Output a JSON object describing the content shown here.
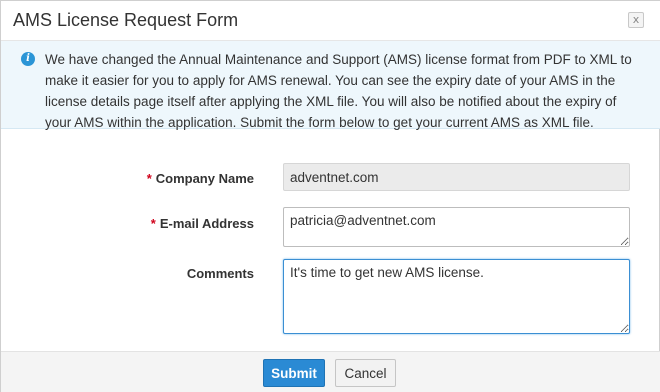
{
  "dialog": {
    "title": "AMS License Request Form",
    "close_glyph": "x"
  },
  "info": {
    "icon": "info-icon",
    "message": "We have changed the Annual Maintenance and Support (AMS) license format from PDF to XML to make it easier for you to apply for AMS renewal. You can see the expiry date of your AMS in the license details page itself after applying the XML file. You will also be notified about the expiry of your AMS within the application. Submit the form below to get your current AMS as XML file."
  },
  "form": {
    "required_mark": "*",
    "company": {
      "label": "Company Name",
      "value": "adventnet.com",
      "required": true
    },
    "email": {
      "label": "E-mail Address",
      "value": "patricia@adventnet.com",
      "required": true
    },
    "comments": {
      "label": "Comments",
      "value": "It's time to get new AMS license.",
      "required": false
    }
  },
  "footer": {
    "submit_label": "Submit",
    "cancel_label": "Cancel"
  },
  "colors": {
    "accent": "#2a8ad4",
    "required": "#d0021b",
    "info_bg": "#eef7fc"
  }
}
